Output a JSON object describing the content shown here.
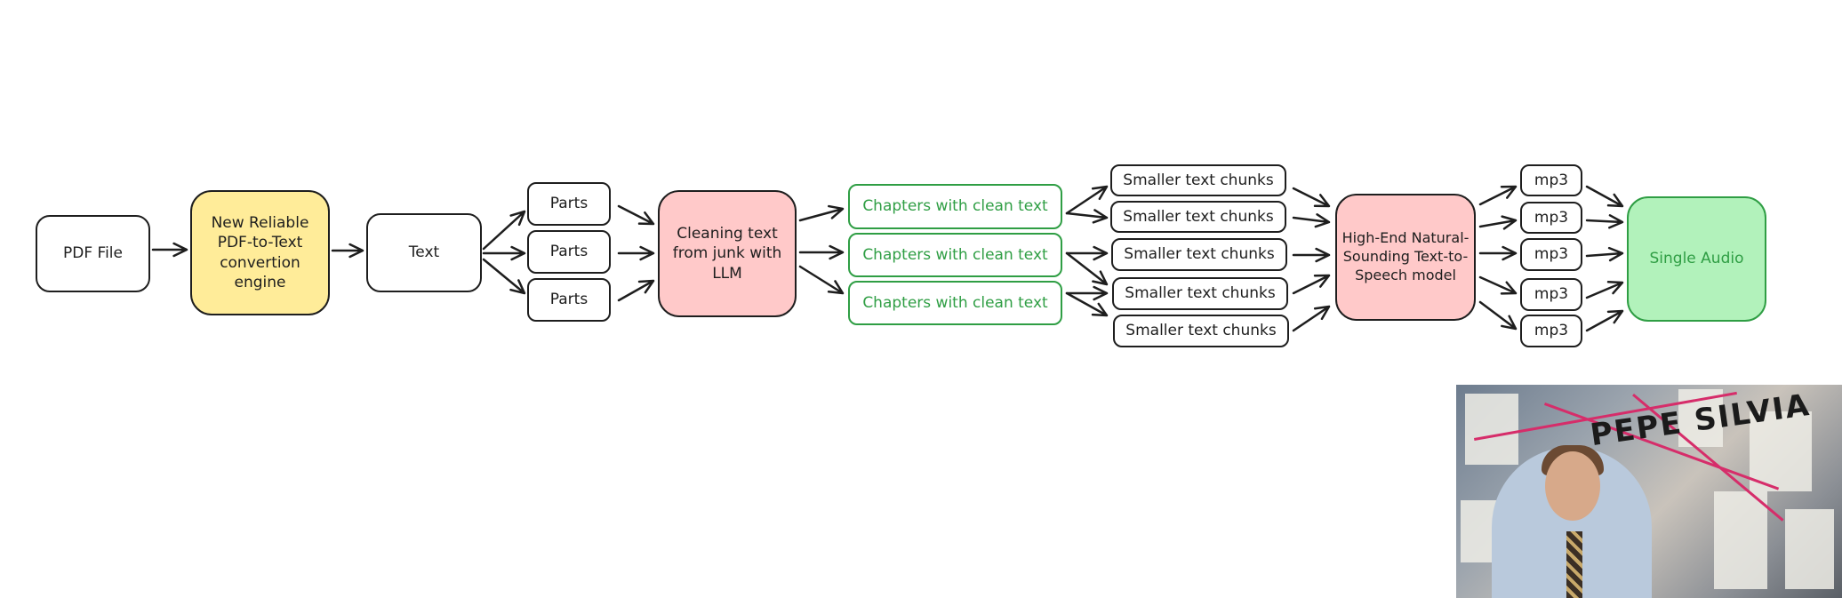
{
  "nodes": {
    "pdf_file": "PDF File",
    "converter": "New Reliable PDF-to-Text convertion engine",
    "text": "Text",
    "parts": [
      "Parts",
      "Parts",
      "Parts"
    ],
    "cleaner": "Cleaning text from junk with LLM",
    "chapters": [
      "Chapters with clean text",
      "Chapters with clean text",
      "Chapters with clean text"
    ],
    "chunks": [
      "Smaller text chunks",
      "Smaller text chunks",
      "Smaller text chunks",
      "Smaller text chunks",
      "Smaller text chunks"
    ],
    "tts": "High-End Natural-Sounding Text-to-Speech model",
    "mp3": [
      "mp3",
      "mp3",
      "mp3",
      "mp3",
      "mp3"
    ],
    "output": "Single Audio"
  },
  "colors": {
    "stroke": "#1e1e1e",
    "yellow_fill": "#ffec99",
    "pink_fill": "#ffc9c9",
    "green_stroke": "#2f9e44",
    "green_fill": "#b2f2bb"
  },
  "meme": {
    "graffiti": "PEPE SILVIA"
  }
}
